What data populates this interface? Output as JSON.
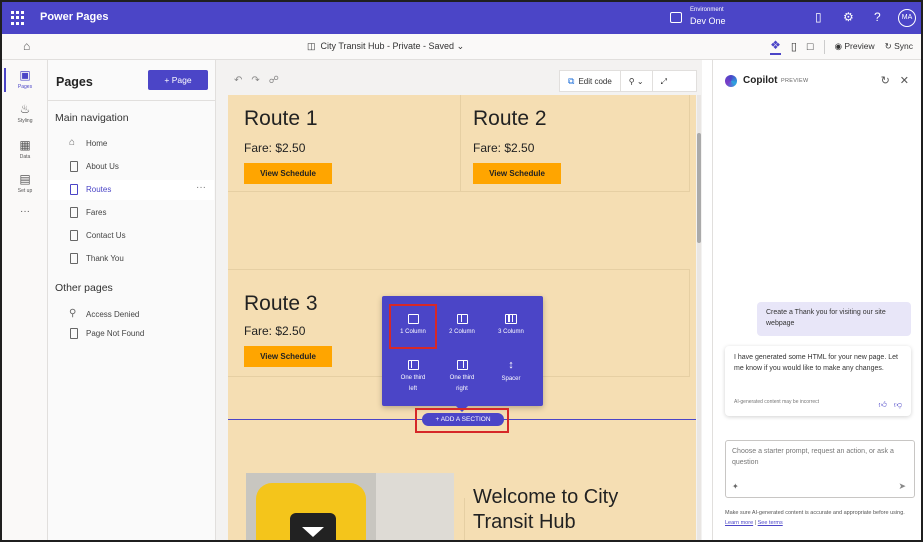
{
  "topbar": {
    "app_name": "Power Pages",
    "environment_label": "Environment",
    "environment_name": "Dev One",
    "user_initials": "MA"
  },
  "subbar": {
    "site_title": "City Transit Hub - Private - Saved",
    "preview_label": "Preview",
    "sync_label": "Sync"
  },
  "rail": {
    "items": [
      {
        "label": "Pages"
      },
      {
        "label": "Styling"
      },
      {
        "label": "Data"
      },
      {
        "label": "Set up"
      }
    ]
  },
  "pages_panel": {
    "title": "Pages",
    "add_button": "Page",
    "main_nav_title": "Main navigation",
    "main_nav": [
      {
        "label": "Home"
      },
      {
        "label": "About Us"
      },
      {
        "label": "Routes"
      },
      {
        "label": "Fares"
      },
      {
        "label": "Contact Us"
      },
      {
        "label": "Thank You"
      }
    ],
    "other_title": "Other pages",
    "other": [
      {
        "label": "Access Denied"
      },
      {
        "label": "Page Not Found"
      }
    ]
  },
  "canvas": {
    "edit_code_label": "Edit code",
    "routes": [
      {
        "title": "Route 1",
        "fare": "Fare: $2.50",
        "button": "View Schedule"
      },
      {
        "title": "Route 2",
        "fare": "Fare: $2.50",
        "button": "View Schedule"
      },
      {
        "title": "Route 3",
        "fare": "Fare: $2.50",
        "button": "View Schedule"
      }
    ],
    "welcome_text": "Welcome to City Transit Hub",
    "add_section_label": "+ ADD A SECTION",
    "section_options": [
      {
        "line1": "1 Column",
        "line2": ""
      },
      {
        "line1": "2 Column",
        "line2": ""
      },
      {
        "line1": "3 Column",
        "line2": ""
      },
      {
        "line1": "One third",
        "line2": "left"
      },
      {
        "line1": "One third",
        "line2": "right"
      },
      {
        "line1": "Spacer",
        "line2": ""
      }
    ]
  },
  "copilot": {
    "title": "Copilot",
    "badge": "PREVIEW",
    "user_message": "Create a Thank you for visiting our site webpage",
    "bot_message": "I have generated some HTML for your new page. Let me know if you would like to make any changes.",
    "disclaimer": "AI-generated content may be incorrect",
    "input_placeholder": "Choose a starter prompt, request an action, or ask a question",
    "footer_text": "Make sure AI-generated content is accurate and appropriate before using.",
    "learn_more": "Learn more",
    "see_terms": "See terms"
  },
  "colors": {
    "brand": "#4b45c7",
    "site_background": "#f5deb3",
    "button_orange": "#ffa500",
    "highlight_red": "#d62828"
  }
}
